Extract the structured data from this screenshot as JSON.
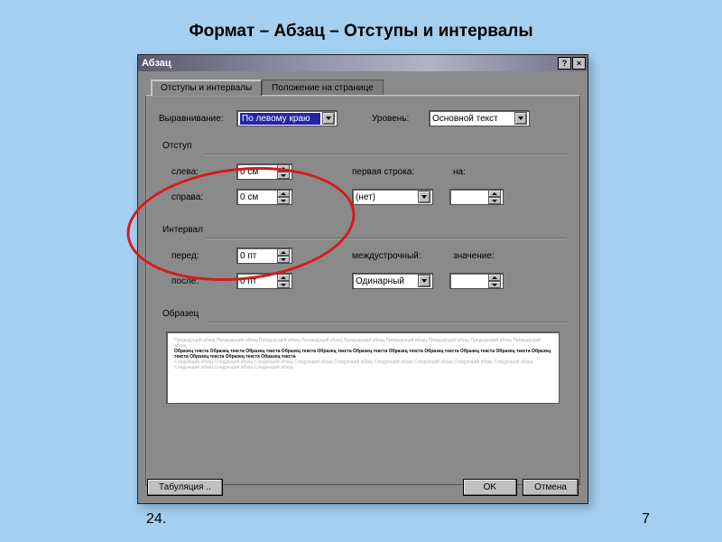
{
  "slide": {
    "title": "Формат – Абзац – Отступы и интервалы",
    "footer_left": "24.",
    "footer_right": "7"
  },
  "dialog": {
    "title": "Абзац",
    "help": "?",
    "close": "×",
    "tabs": {
      "active": "Отступы и интервалы",
      "inactive": "Положение на странице"
    },
    "alignment": {
      "label": "Выравнивание:",
      "value": "По левому краю"
    },
    "level": {
      "label": "Уровень:",
      "value": "Основной текст"
    },
    "group_indent": "Отступ",
    "left": {
      "label": "слева:",
      "value": "0 см"
    },
    "right": {
      "label": "справа:",
      "value": "0 см"
    },
    "firstline": {
      "label": "первая строка:",
      "value": "(нет)"
    },
    "by1": {
      "label": "на:"
    },
    "group_spacing": "Интервал",
    "before": {
      "label": "перед:",
      "value": "0 пт"
    },
    "after": {
      "label": "после:",
      "value": "0 пт"
    },
    "linespacing": {
      "label": "междустрочный:",
      "value": "Одинарный"
    },
    "by2": {
      "label": "значение:"
    },
    "group_preview": "Образец",
    "preview_light": "Предыдущий абзац Предыдущий абзац Предыдущий абзац Предыдущий абзац Предыдущий абзац Предыдущий абзац Предыдущий абзац Предыдущий абзац Предыдущий абзац",
    "preview_dark": "Образец текста Образец текста Образец текста Образец текста Образец текста Образец текста Образец текста Образец текста Образец текста Образец текста Образец текста Образец текста Образец текста Образец текста",
    "preview_after": "Следующий абзац Следующий абзац Следующий абзац Следующий абзац Следующий абзац Следующий абзац Следующий абзац Следующий абзац Следующий абзац Следующий абзац Следующий абзац Следующий абзац",
    "buttons": {
      "tabs": "Табуляция ..",
      "ok": "OK",
      "cancel": "Отмена"
    }
  }
}
